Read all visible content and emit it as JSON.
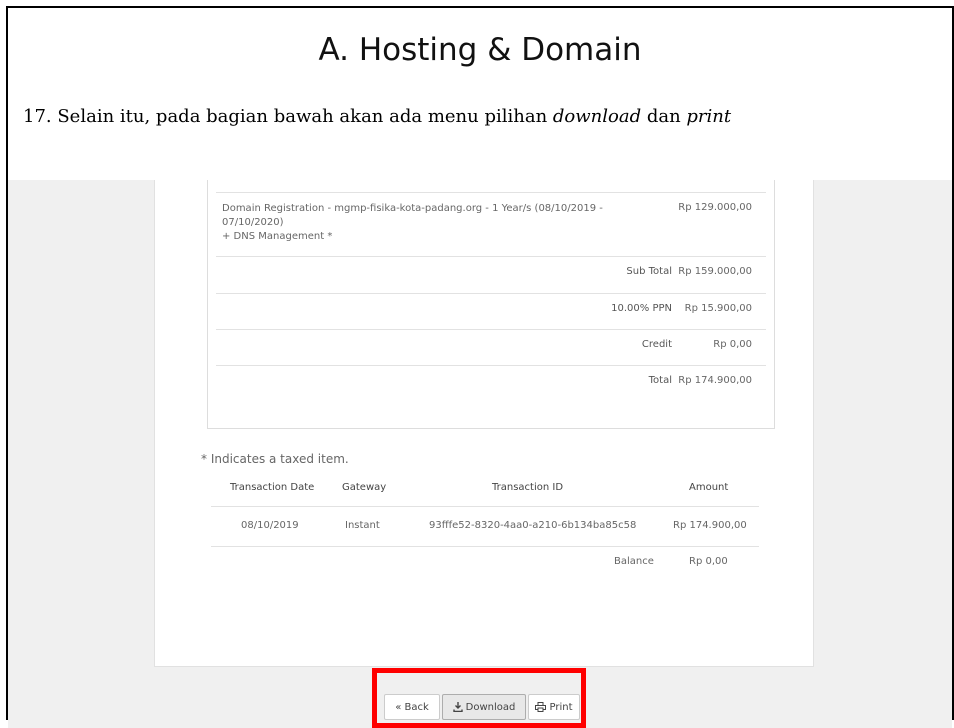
{
  "slide": {
    "title": "A. Hosting & Domain",
    "step_prefix": "17. Selain itu, pada bagian bawah akan ada menu pilihan ",
    "step_em1": "download",
    "step_mid": " dan ",
    "step_em2": "print"
  },
  "invoice": {
    "item": {
      "description_line1": "Domain Registration - mgmp-fisika-kota-padang.org - 1 Year/s (08/10/2019 -",
      "description_line2": "07/10/2020)",
      "description_line3": "+ DNS Management *",
      "amount": "Rp 129.000,00"
    },
    "summary": [
      {
        "label": "Sub Total",
        "value": "Rp 159.000,00"
      },
      {
        "label": "10.00% PPN",
        "value": "Rp 15.900,00"
      },
      {
        "label": "Credit",
        "value": "Rp 0,00"
      },
      {
        "label": "Total",
        "value": "Rp 174.900,00"
      }
    ],
    "taxed_note": "* Indicates a taxed item.",
    "transactions": {
      "headers": [
        "Transaction Date",
        "Gateway",
        "Transaction ID",
        "Amount"
      ],
      "rows": [
        [
          "08/10/2019",
          "Instant",
          "93fffe52-8320-4aa0-a210-6b134ba85c58",
          "Rp 174.900,00"
        ]
      ],
      "balance_label": "Balance",
      "balance_value": "Rp 0,00"
    }
  },
  "buttons": {
    "back": "« Back",
    "download": "Download",
    "print": "Print"
  },
  "colors": {
    "highlight": "#ff0000",
    "page_bg": "#f0f0f0"
  }
}
